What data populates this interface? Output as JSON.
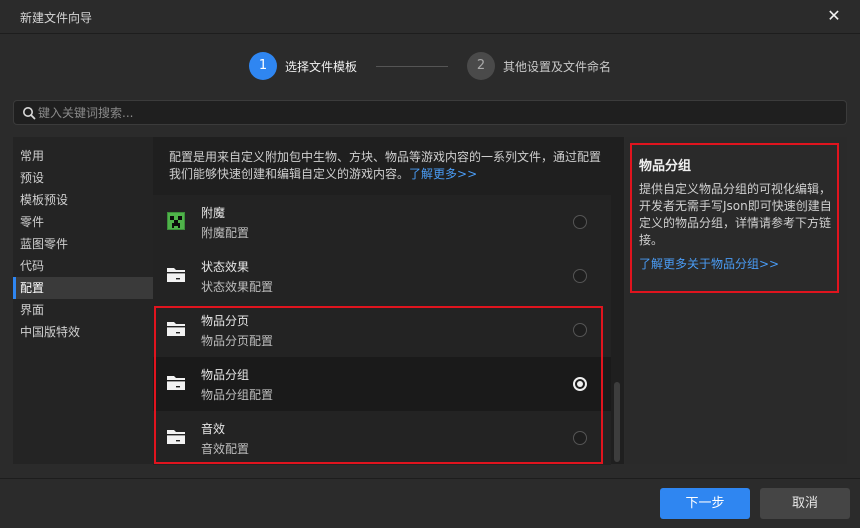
{
  "window": {
    "title": "新建文件向导"
  },
  "steps": [
    {
      "number": "1",
      "label": "选择文件模板"
    },
    {
      "number": "2",
      "label": "其他设置及文件命名"
    }
  ],
  "search": {
    "placeholder": "键入关键词搜索...",
    "value": ""
  },
  "sidebar": {
    "items": [
      {
        "label": "常用"
      },
      {
        "label": "预设"
      },
      {
        "label": "模板预设"
      },
      {
        "label": "零件"
      },
      {
        "label": "蓝图零件"
      },
      {
        "label": "代码"
      },
      {
        "label": "配置",
        "active": true
      },
      {
        "label": "界面"
      },
      {
        "label": "中国版特效"
      }
    ]
  },
  "main": {
    "description": "配置是用来自定义附加包中生物、方块、物品等游戏内容的一系列文件，通过配置我们能够快速创建和编辑自定义的游戏内容。",
    "description_link": "了解更多>>",
    "items": [
      {
        "title": "附魔",
        "subtitle": "附魔配置",
        "icon": "creeper-icon",
        "selected": false
      },
      {
        "title": "状态效果",
        "subtitle": "状态效果配置",
        "icon": "folder-icon",
        "selected": false
      },
      {
        "title": "物品分页",
        "subtitle": "物品分页配置",
        "icon": "folder-icon",
        "selected": false
      },
      {
        "title": "物品分组",
        "subtitle": "物品分组配置",
        "icon": "folder-icon",
        "selected": true
      },
      {
        "title": "音效",
        "subtitle": "音效配置",
        "icon": "folder-icon",
        "selected": false
      }
    ]
  },
  "detail": {
    "title": "物品分组",
    "text": "提供自定义物品分组的可视化编辑，开发者无需手写Json即可快速创建自定义的物品分组，详情请参考下方链接。",
    "link": "了解更多关于物品分组>>"
  },
  "footer": {
    "next_label": "下一步",
    "cancel_label": "取消"
  },
  "colors": {
    "accent": "#2f86f1",
    "highlight": "#e0141e",
    "link": "#4a9cf5"
  }
}
